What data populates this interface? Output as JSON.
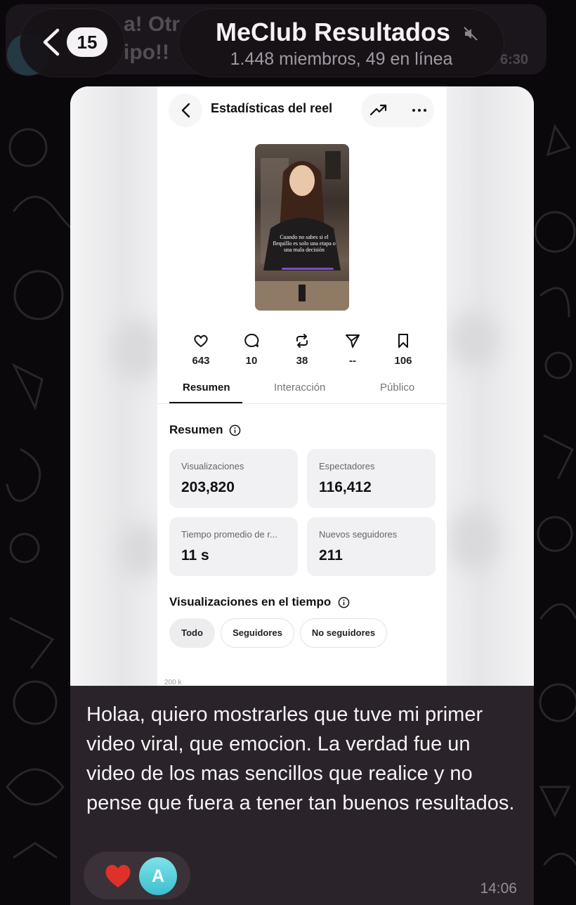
{
  "header": {
    "unread_count": "15",
    "title": "MeClub Resultados",
    "subtitle": "1.448 miembros, 49 en línea",
    "muted": true
  },
  "background_message": {
    "fragment_top": "a! Otr",
    "fragment_bottom": "ipo!!",
    "time_fragment": "6:30"
  },
  "screenshot": {
    "topbar_title": "Estadísticas del reel",
    "video_caption": "Cuando no sabes si el flequillo es solo una etapa o una mala decisión",
    "stats": [
      {
        "icon": "heart-icon",
        "value": "643"
      },
      {
        "icon": "comment-icon",
        "value": "10"
      },
      {
        "icon": "repost-icon",
        "value": "38"
      },
      {
        "icon": "send-icon",
        "value": "--"
      },
      {
        "icon": "bookmark-icon",
        "value": "106"
      }
    ],
    "tabs": [
      "Resumen",
      "Interacción",
      "Público"
    ],
    "active_tab": "Resumen",
    "summary_title": "Resumen",
    "cards": [
      {
        "label": "Visualizaciones",
        "value": "203,820"
      },
      {
        "label": "Espectadores",
        "value": "116,412"
      },
      {
        "label": "Tiempo promedio de r...",
        "value": "11 s"
      },
      {
        "label": "Nuevos seguidores",
        "value": "211"
      }
    ],
    "views_over_time_title": "Visualizaciones en el tiempo",
    "filters": [
      "Todo",
      "Seguidores",
      "No seguidores"
    ],
    "active_filter": "Todo",
    "axis_peek": "200 k"
  },
  "message": {
    "text": "Holaa, quiero mostrarles que tuve mi primer video viral, que emocion. La verdad fue un video de los mas sencillos que realice y no pense que fuera a tener tan buenos resultados.",
    "time": "14:06",
    "reaction_avatar_initial": "A"
  },
  "colors": {
    "background": "#0a080b",
    "bubble": "#2a2329",
    "reaction_heart": "#e0302a",
    "avatar": "#4cc6d4"
  }
}
